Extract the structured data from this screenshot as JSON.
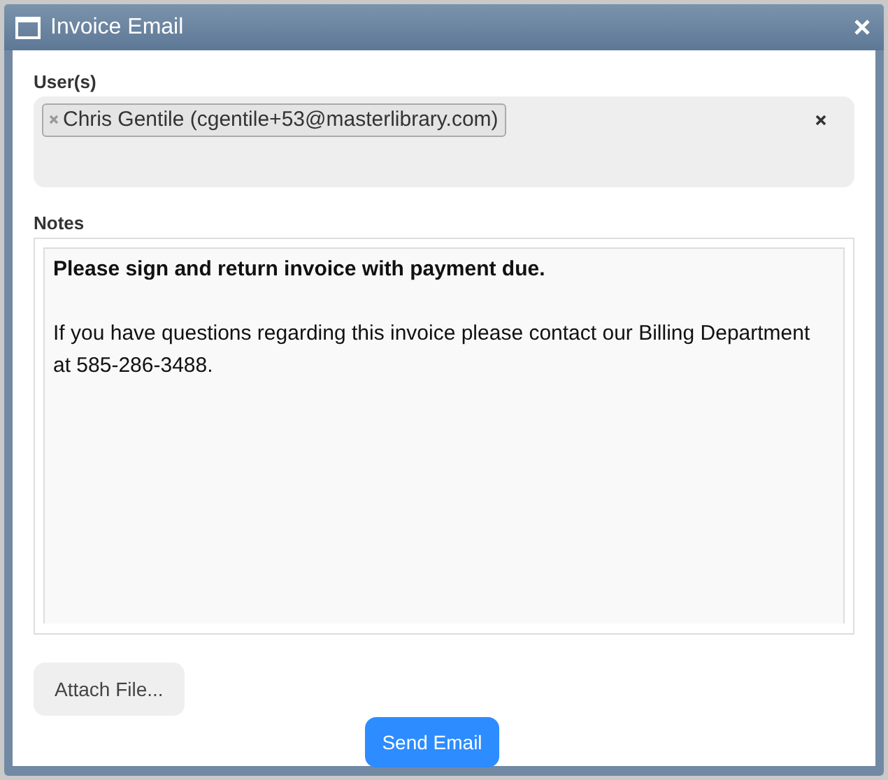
{
  "window": {
    "title": "Invoice Email"
  },
  "users": {
    "label": "User(s)",
    "tags": [
      {
        "text": "Chris Gentile (cgentile+53@masterlibrary.com)"
      }
    ]
  },
  "notes": {
    "label": "Notes",
    "paragraphs": [
      {
        "text": "Please sign and return invoice with payment due.",
        "bold": true
      },
      {
        "text": "If you have questions regarding this invoice please contact our Billing Department at 585-286-3488.",
        "bold": false
      }
    ]
  },
  "buttons": [
    {
      "label": "Attach File...",
      "kind": "secondary"
    },
    {
      "label": "Send Email",
      "kind": "primary"
    }
  ]
}
